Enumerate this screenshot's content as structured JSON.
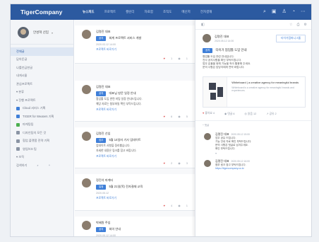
{
  "nav": {
    "logo": "TigerCompany",
    "tabs": [
      "뉴스피드",
      "프로젝트",
      "캘린더",
      "자료함",
      "조직도",
      "메신저",
      "전자결재"
    ],
    "icons": [
      "search-icon",
      "calendar-icon",
      "user-icon",
      "bell-icon",
      "more-icon"
    ]
  },
  "sidebar": {
    "profile_name": "안성혁 선임",
    "items": [
      {
        "label": "전체글",
        "active": true,
        "color": ""
      },
      {
        "label": "담아둔글",
        "active": false,
        "color": ""
      },
      {
        "label": "나를언급한글",
        "active": false,
        "color": ""
      },
      {
        "label": "내게시물",
        "active": false,
        "color": ""
      },
      {
        "label": "관심프로젝트",
        "active": false,
        "color": ""
      },
      {
        "label": "▾ 분류",
        "active": false,
        "color": ""
      },
      {
        "label": "▾ 진행 프로젝트",
        "active": false,
        "color": ""
      },
      {
        "label": "Cloud 서비스 기획",
        "active": false,
        "color": "#3f7fd8"
      },
      {
        "label": "TIGER for Weaters 기획",
        "active": false,
        "color": "#3f7fd8"
      },
      {
        "label": "마케팅팀",
        "active": false,
        "color": "#4caf50"
      },
      {
        "label": "디자인팀의 모든 것",
        "active": false,
        "color": "#8a94a4"
      },
      {
        "label": "협업 플랫폼 전략 기획",
        "active": false,
        "color": "#8a94a4"
      },
      {
        "label": "영업/CS 팀",
        "active": false,
        "color": "#8a94a4"
      },
      {
        "label": "▾ 조직",
        "active": false,
        "color": ""
      }
    ],
    "footer": "검색하기"
  },
  "feed": {
    "posts": [
      {
        "name": "김명진 대표",
        "tag": "공지",
        "title": "회계 프로젝트 서비스 개발",
        "meta": "2020.03.12 14:00",
        "lines": [],
        "link": "프로젝트 바로가기",
        "likes": "1",
        "comments": "1"
      },
      {
        "name": "김명진 대표",
        "tag": "공지",
        "title": "대표님 방문 일정 안내",
        "meta": "",
        "lines": [
          "협업툴 도입 관련 미팅 일정 안내드립니다.",
          "해당 자료는 첨부파일 확인 부탁드립니다."
        ],
        "link": "프로젝트 바로가기",
        "likes": "6",
        "comments": "5"
      },
      {
        "name": "김명진 선임",
        "tag": "업무",
        "title": "5월 14일자 기사 업데이트",
        "meta": "",
        "lines": [
          "업데이트 사항을 정리했습니다.",
          "자세한 내용은 링크를 참고 바랍니다."
        ],
        "link": "프로젝트 바로가기",
        "likes": "2",
        "comments": "3"
      },
      {
        "name": "정진석 마케터",
        "tag": "일정",
        "title": "5월 21일(목) 전자결재 교육",
        "meta": "2020.05.12",
        "lines": [],
        "link": "프로젝트 바로가기",
        "likes": "4",
        "comments": "1"
      },
      {
        "name": "박혜원 주임",
        "tag": "공지",
        "title": "회의 안내",
        "meta": "2020.05.12 14:00",
        "lines": [],
        "link": "",
        "likes": "",
        "comments": ""
      }
    ]
  },
  "detail": {
    "author": "김명진 대표",
    "time": "2020.05.12 14:00",
    "follow_label": "타이거컴퍼니그룹",
    "tag": "공지",
    "title": "타이거 협업툴 도입 안내",
    "lines": [
      "협업툴 도입 관련 안내입니다.",
      "전사 공지사항을 확인 부탁드립니다.",
      "업무 효율을 위해 기능을 적극 활용해 주세요.",
      "문의 사항은 담당자에게 연락 바랍니다."
    ],
    "card": {
      "title": "Whiteboard | a creative agency for meaningful brands",
      "desc": "Whiteboard is a creative agency for meaningful brands and experiences."
    },
    "actions": {
      "like": "좋아요 4",
      "comment": "댓글 6",
      "read": "읽음 12",
      "share": "공유 2"
    },
    "comment_section": "댓글",
    "comments": [
      {
        "name": "김명진 대표",
        "time": "2020.05.12 15:00",
        "lines": [
          "업무 공유 드립니다.",
          "기능 안내 자료 확인 부탁드립니다.",
          "문의 사항은 댓글로 남겨주세요.",
          "확인 부탁드립니다."
        ],
        "link": ""
      },
      {
        "name": "김명진 대표",
        "time": "2020.05.12 16:00",
        "lines": [
          "첨부 링크 참고 부탁드립니다."
        ],
        "link": "https://tigercompany.co.kr"
      }
    ]
  },
  "colors": {
    "brand": "#2c5aa0",
    "accent": "#3f7fd8",
    "like": "#e05a5a"
  }
}
